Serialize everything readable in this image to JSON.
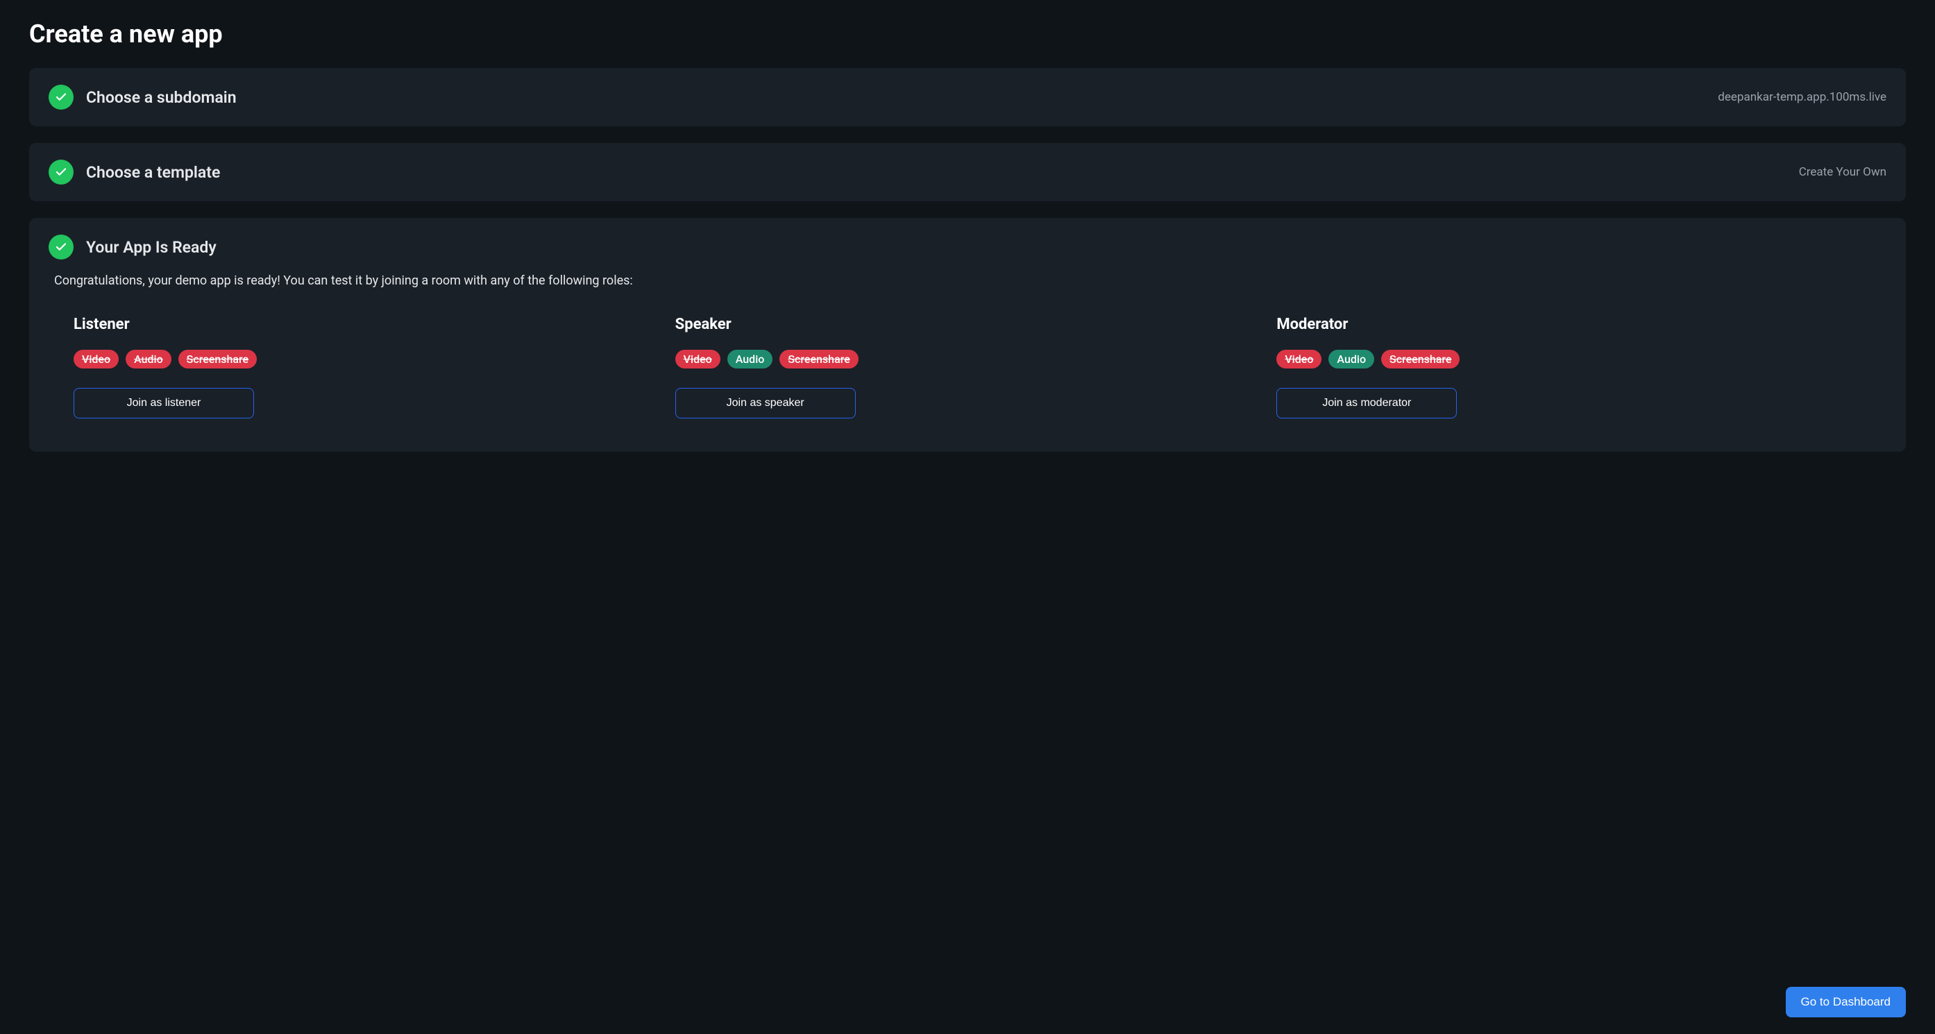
{
  "page_title": "Create a new app",
  "steps": {
    "subdomain": {
      "title": "Choose a subdomain",
      "value": "deepankar-temp.app.100ms.live"
    },
    "template": {
      "title": "Choose a template",
      "value": "Create Your Own"
    },
    "ready": {
      "title": "Your App Is Ready"
    }
  },
  "congrats_text": "Congratulations, your demo app is ready! You can test it by joining a room with any of the following roles:",
  "roles": [
    {
      "name": "Listener",
      "badges": [
        {
          "label": "Video",
          "enabled": false
        },
        {
          "label": "Audio",
          "enabled": false
        },
        {
          "label": "Screenshare",
          "enabled": false
        }
      ],
      "join_label": "Join as listener"
    },
    {
      "name": "Speaker",
      "badges": [
        {
          "label": "Video",
          "enabled": false
        },
        {
          "label": "Audio",
          "enabled": true
        },
        {
          "label": "Screenshare",
          "enabled": false
        }
      ],
      "join_label": "Join as speaker"
    },
    {
      "name": "Moderator",
      "badges": [
        {
          "label": "Video",
          "enabled": false
        },
        {
          "label": "Audio",
          "enabled": true
        },
        {
          "label": "Screenshare",
          "enabled": false
        }
      ],
      "join_label": "Join as moderator"
    }
  ],
  "dashboard_button": "Go to Dashboard",
  "icons": {
    "check": "check-icon"
  },
  "colors": {
    "bg": "#0f1419",
    "card": "#1a2028",
    "green": "#22c55e",
    "red_badge": "#dc3545",
    "green_badge": "#1f8b6e",
    "blue_border": "#2563eb",
    "blue_button": "#2f80ed",
    "muted_text": "#9aa2ab"
  }
}
